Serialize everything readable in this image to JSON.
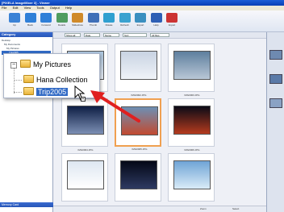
{
  "window": {
    "title": "[PIXELA ImageMixer 3] - Viewer",
    "title_bar_color": "#0a3fb4"
  },
  "menu": [
    "File",
    "Edit",
    "View",
    "Tools",
    "Output",
    "Help"
  ],
  "toolbar": {
    "buttons": [
      {
        "label": "Up",
        "icon": "folder-up-icon",
        "color": "#3b82d6"
      },
      {
        "label": "Back",
        "icon": "back-arrow-icon",
        "color": "#2f7fd8"
      },
      {
        "label": "Forward",
        "icon": "forward-arrow-icon",
        "color": "#2f7fd8"
      },
      {
        "label": "Details",
        "icon": "details-icon",
        "color": "#4f9c5f"
      },
      {
        "label": "Slideshow",
        "icon": "slideshow-icon",
        "color": "#d08a2a"
      },
      {
        "label": "Thumb",
        "icon": "thumbnails-icon",
        "color": "#3f6fb8"
      },
      {
        "label": "Rotate",
        "icon": "rotate-icon",
        "color": "#2f9fd0"
      },
      {
        "label": "Refresh",
        "icon": "refresh-icon",
        "color": "#3aa2d0"
      },
      {
        "label": "Export",
        "icon": "export-icon",
        "color": "#3a8fc0"
      },
      {
        "label": "Help",
        "icon": "help-icon",
        "color": "#2e5fb5"
      },
      {
        "label": "Import",
        "icon": "import-icon",
        "color": "#cc3333"
      }
    ]
  },
  "left_pane": {
    "header": "Category",
    "small_tree": [
      "Desktop",
      "My Documents",
      "My Pictures",
      "Trip2005"
    ],
    "footer": "Memory Card"
  },
  "zoom_tree": {
    "items": [
      {
        "label": "My Pictures"
      },
      {
        "label": "Hana Collection"
      },
      {
        "label": "Trip2005",
        "selected": true
      }
    ],
    "expander": "−",
    "cursor_badge": "+"
  },
  "filter_bar": {
    "fields": [
      "Show all",
      "Date",
      "Name",
      "Sort",
      "All files"
    ]
  },
  "thumbnails": [
    {
      "caption": "IMG0001.JPG",
      "colors": [
        "#aac4dd",
        "#e8eef6"
      ]
    },
    {
      "caption": "IMG0002.JPG",
      "colors": [
        "#c8d3e2",
        "#f0f3f8"
      ]
    },
    {
      "caption": "IMG0003.JPG",
      "colors": [
        "#5e7f9e",
        "#b9c7d6"
      ]
    },
    {
      "caption": "IMG0004.JPG",
      "colors": [
        "#0e1e44",
        "#7c8fb4"
      ]
    },
    {
      "caption": "IMG0005.JPG",
      "colors": [
        "#6d8fb4",
        "#c24a30"
      ],
      "selected": true
    },
    {
      "caption": "IMG0006.JPG",
      "colors": [
        "#0a0a16",
        "#b53b1e"
      ]
    },
    {
      "caption": "",
      "colors": [
        "#dde7f1",
        "#ffffff"
      ]
    },
    {
      "caption": "",
      "colors": [
        "#040816",
        "#2e3a62"
      ]
    },
    {
      "caption": "",
      "colors": [
        "#6fa4d6",
        "#d9ebf7"
      ]
    }
  ],
  "status": {
    "items": [
      "Zoom",
      "Select"
    ]
  }
}
